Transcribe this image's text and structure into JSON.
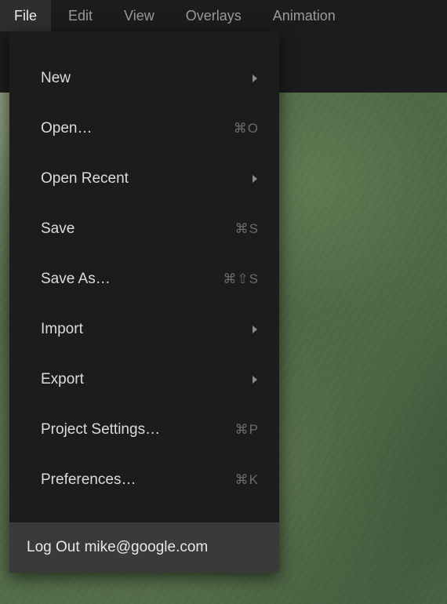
{
  "menubar": {
    "items": [
      {
        "label": "File",
        "active": true
      },
      {
        "label": "Edit"
      },
      {
        "label": "View"
      },
      {
        "label": "Overlays"
      },
      {
        "label": "Animation"
      }
    ]
  },
  "menu": {
    "items": [
      {
        "label": "New",
        "shortcut": "",
        "submenu": true
      },
      {
        "label": "Open…",
        "shortcut": "⌘O",
        "submenu": false
      },
      {
        "label": "Open Recent",
        "shortcut": "",
        "submenu": true
      },
      {
        "label": "Save",
        "shortcut": "⌘S",
        "submenu": false
      },
      {
        "label": "Save As…",
        "shortcut": "⌘⇧S",
        "submenu": false
      },
      {
        "label": "Import",
        "shortcut": "",
        "submenu": true
      },
      {
        "label": "Export",
        "shortcut": "",
        "submenu": true
      },
      {
        "label": "Project Settings…",
        "shortcut": "⌘P",
        "submenu": false
      },
      {
        "label": "Preferences…",
        "shortcut": "⌘K",
        "submenu": false
      }
    ],
    "logout_prefix": "Log Out",
    "logout_email": "mike@google.com"
  }
}
